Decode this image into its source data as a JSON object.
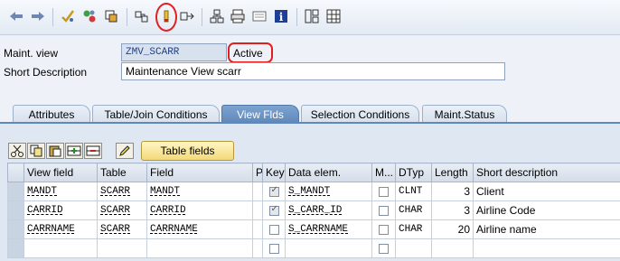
{
  "toolbar": {
    "buttons": [
      "back-icon",
      "forward-icon",
      "check-icon",
      "other-object-icon",
      "where-used-icon",
      "display-object-list-icon",
      "activate-icon",
      "navigate-icon",
      "hierarchy-icon",
      "print-icon",
      "list-icon",
      "info-icon",
      "table-icon",
      "grid-icon"
    ]
  },
  "header": {
    "maint_view_label": "Maint. view",
    "maint_view_value": "ZMV_SCARR",
    "status": "Active",
    "short_desc_label": "Short Description",
    "short_desc_value": "Maintenance View scarr"
  },
  "tabs": [
    "Attributes",
    "Table/Join Conditions",
    "View Flds",
    "Selection Conditions",
    "Maint.Status"
  ],
  "active_tab": "View Flds",
  "table_fields_button": "Table fields",
  "grid": {
    "columns": [
      "View field",
      "Table",
      "Field",
      "P",
      "Key",
      "Data elem.",
      "M...",
      "DTyp",
      "Length",
      "Short description"
    ],
    "rows": [
      {
        "view_field": "MANDT",
        "table": "SCARR",
        "field": "MANDT",
        "key": true,
        "data_elem": "S_MANDT",
        "mod": false,
        "dtyp": "CLNT",
        "length": "3",
        "desc": "Client"
      },
      {
        "view_field": "CARRID",
        "table": "SCARR",
        "field": "CARRID",
        "key": true,
        "data_elem": "S_CARR_ID",
        "mod": false,
        "dtyp": "CHAR",
        "length": "3",
        "desc": "Airline Code"
      },
      {
        "view_field": "CARRNAME",
        "table": "SCARR",
        "field": "CARRNAME",
        "key": false,
        "data_elem": "S_CARRNAME",
        "mod": false,
        "dtyp": "CHAR",
        "length": "20",
        "desc": "Airline name"
      }
    ]
  },
  "colors": {
    "annotation": "#e02020",
    "active_tab": "#5f88bb"
  }
}
